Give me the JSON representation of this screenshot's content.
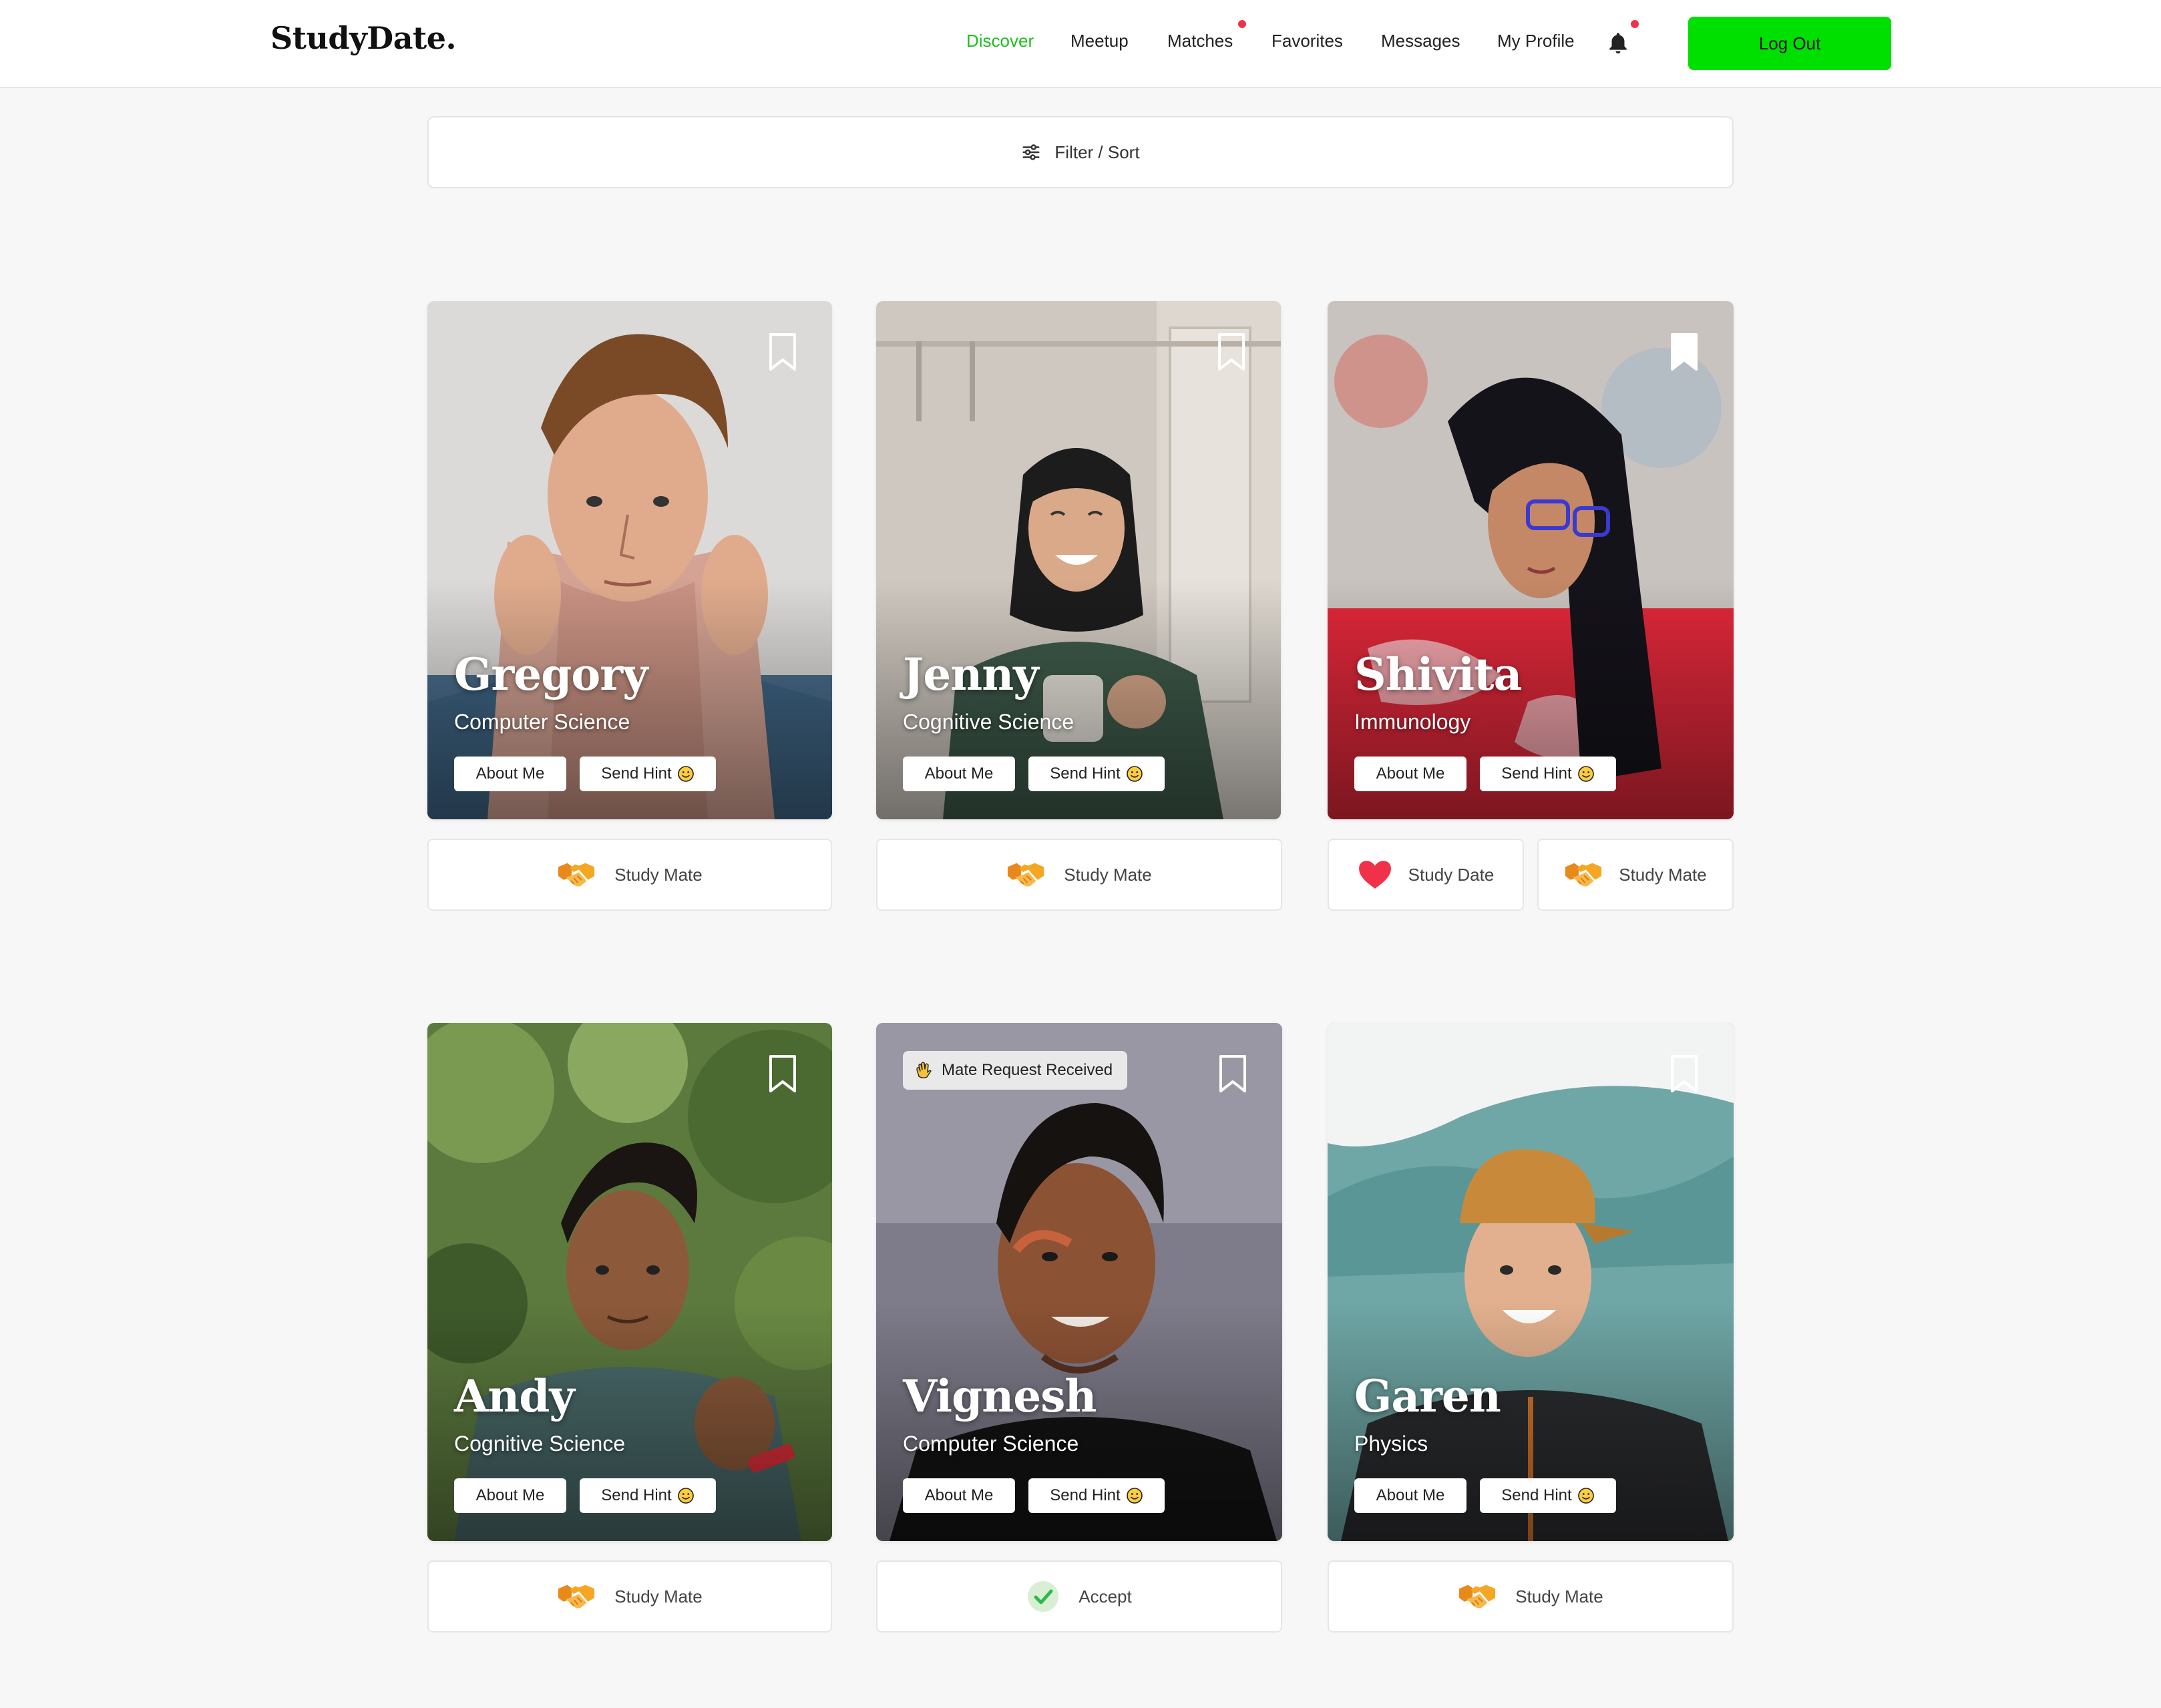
{
  "brand": "StudyDate.",
  "nav": {
    "items": [
      {
        "label": "Discover",
        "active": true
      },
      {
        "label": "Meetup"
      },
      {
        "label": "Matches",
        "notify": true
      },
      {
        "label": "Favorites"
      },
      {
        "label": "Messages"
      },
      {
        "label": "My Profile"
      }
    ],
    "bell_icon": "bell-icon",
    "logout_label": "Log Out",
    "accent": "#00e000"
  },
  "filter": {
    "label": "Filter / Sort",
    "icon": "sliders-icon"
  },
  "cards": [
    {
      "name": "Gregory",
      "major": "Computer Science",
      "about": "About Me",
      "hint": "Send Hint",
      "bookmarked": false,
      "actions": [
        {
          "label": "Study Mate",
          "icon": "handshake-icon"
        }
      ]
    },
    {
      "name": "Jenny",
      "major": "Cognitive Science",
      "about": "About Me",
      "hint": "Send Hint",
      "bookmarked": false,
      "actions": [
        {
          "label": "Study Mate",
          "icon": "handshake-icon"
        }
      ]
    },
    {
      "name": "Shivita",
      "major": "Immunology",
      "about": "About Me",
      "hint": "Send Hint",
      "bookmarked": true,
      "actions": [
        {
          "label": "Study Date",
          "icon": "heart-icon"
        },
        {
          "label": "Study Mate",
          "icon": "handshake-icon"
        }
      ]
    },
    {
      "name": "Andy",
      "major": "Cognitive Science",
      "about": "About Me",
      "hint": "Send Hint",
      "bookmarked": false,
      "actions": [
        {
          "label": "Study Mate",
          "icon": "handshake-icon"
        }
      ]
    },
    {
      "name": "Vignesh",
      "major": "Computer Science",
      "about": "About Me",
      "hint": "Send Hint",
      "bookmarked": false,
      "badge": "Mate Request Received",
      "actions": [
        {
          "label": "Accept",
          "icon": "check-icon"
        }
      ]
    },
    {
      "name": "Garen",
      "major": "Physics",
      "about": "About Me",
      "hint": "Send Hint",
      "bookmarked": false,
      "actions": [
        {
          "label": "Study Mate",
          "icon": "handshake-icon"
        }
      ]
    }
  ]
}
